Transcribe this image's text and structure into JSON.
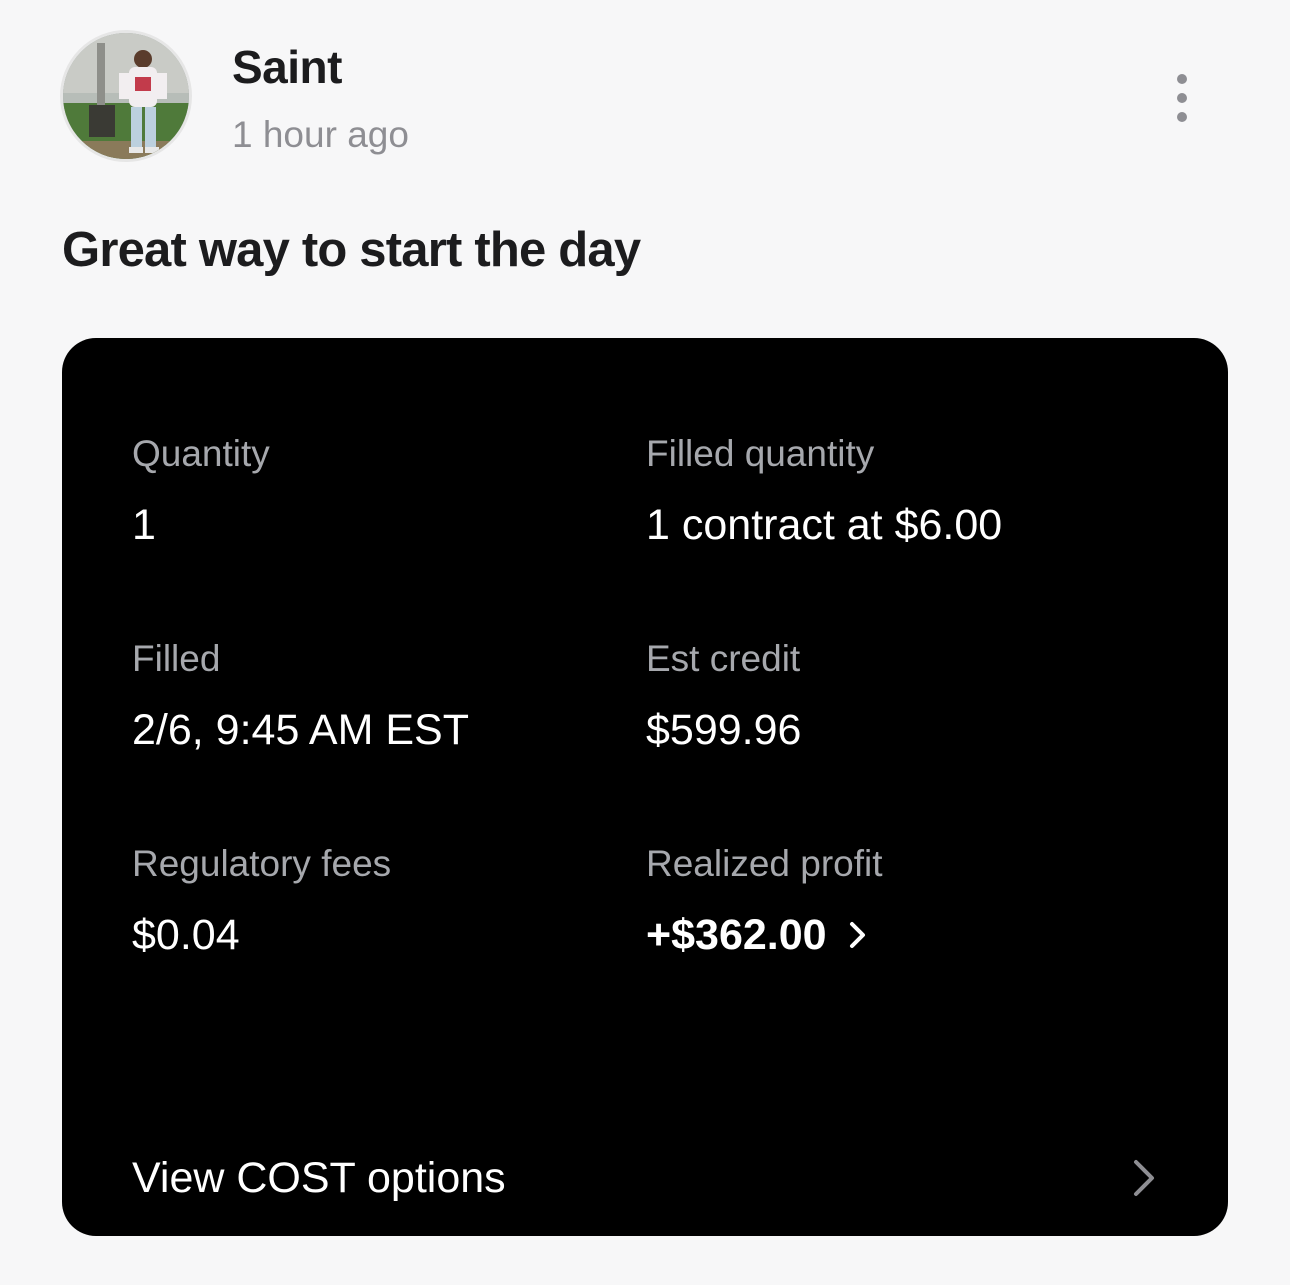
{
  "post": {
    "author": "Saint",
    "time": "1 hour ago",
    "caption": "Great way to start the day",
    "icons": {
      "avatar": "user-photo",
      "menu": "more-vertical-icon"
    }
  },
  "order": {
    "quantity": {
      "label": "Quantity",
      "value": "1"
    },
    "filled_quantity": {
      "label": "Filled quantity",
      "value": "1 contract at $6.00"
    },
    "filled": {
      "label": "Filled",
      "value": "2/6, 9:45 AM EST"
    },
    "est_credit": {
      "label": "Est credit",
      "value": "$599.96"
    },
    "regulatory_fees": {
      "label": "Regulatory fees",
      "value": "$0.04"
    },
    "realized_profit": {
      "label": "Realized profit",
      "value": "+$362.00"
    },
    "footer": {
      "label": "View COST options"
    },
    "colors": {
      "card_background": "#000000",
      "label": "#a6a8ad",
      "value": "#ffffff",
      "chevron": "#8e8e93"
    }
  }
}
